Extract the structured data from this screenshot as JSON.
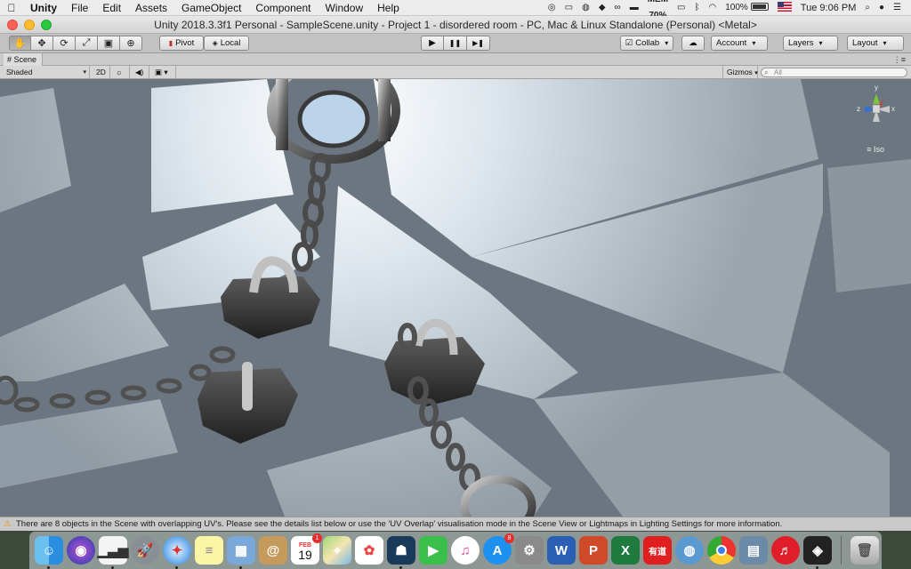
{
  "menubar": {
    "apple": "",
    "app": "Unity",
    "items": [
      "File",
      "Edit",
      "Assets",
      "GameObject",
      "Component",
      "Window",
      "Help"
    ],
    "mem_label": "MEM",
    "mem_value": "70%",
    "battery": "100%",
    "clock": "Tue 9:06 PM",
    "tray_icons": [
      "creative-cloud-icon",
      "messages-icon",
      "cpu-icon",
      "dropbox-icon",
      "adobe-icon",
      "memory-icon",
      "airplay-icon",
      "bluetooth-icon",
      "wifi-icon",
      "battery-icon",
      "us-flag-icon",
      "search-icon",
      "siri-icon",
      "list-icon"
    ]
  },
  "window": {
    "title": "Unity 2018.3.3f1 Personal - SampleScene.unity - Project 1 - disordered room - PC, Mac & Linux Standalone (Personal) <Metal>"
  },
  "toolbar": {
    "tools": [
      "hand-tool-icon",
      "move-tool-icon",
      "rotate-tool-icon",
      "scale-tool-icon",
      "rect-tool-icon",
      "transform-tool-icon"
    ],
    "pivot": "Pivot",
    "local": "Local",
    "play": "▶",
    "pause": "❚❚",
    "step": "▶❚",
    "collab": "Collab",
    "account": "Account",
    "layers": "Layers",
    "layout": "Layout"
  },
  "scene": {
    "tab_label": "Scene",
    "shading": "Shaded",
    "mode_2d": "2D",
    "gizmos": "Gizmos",
    "search_placeholder": "All",
    "projection": "Iso",
    "axis_x": "x",
    "axis_y": "y",
    "axis_z": "z"
  },
  "status": {
    "message": "There are 8 objects in the Scene with overlapping UV's. Please see the details list below or use the 'UV Overlap' visualisation mode in the Scene View or Lightmaps in Lighting Settings for more information."
  },
  "dock": {
    "calendar_month": "FEB",
    "calendar_day": "19",
    "calendar_badge": "1",
    "appstore_badge": "8",
    "youdao": "有道",
    "apps": [
      "finder-icon",
      "siri-icon",
      "activity-monitor-icon",
      "launchpad-icon",
      "safari-icon",
      "notes-icon",
      "preview-icon",
      "contacts-icon",
      "calendar-icon",
      "maps-icon",
      "photos-icon",
      "kindle-icon",
      "facetime-icon",
      "itunes-icon",
      "app-store-icon",
      "system-preferences-icon",
      "word-icon",
      "powerpoint-icon",
      "excel-icon",
      "youdao-icon",
      "vpn-icon",
      "chrome-icon",
      "image-capture-icon",
      "netease-music-icon",
      "unity-icon",
      "trash-icon"
    ]
  }
}
